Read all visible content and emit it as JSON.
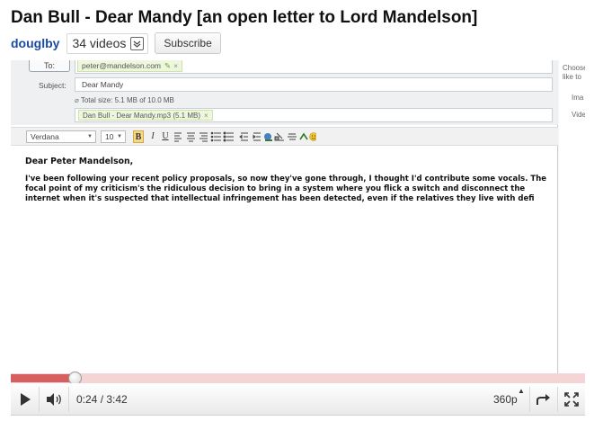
{
  "header": {
    "title": "Dan Bull - Dear Mandy [an open letter to Lord Mandelson]",
    "channel": "douglby",
    "videos_count": "34 videos",
    "subscribe_label": "Subscribe"
  },
  "email": {
    "to_button": "To:",
    "to_value": "peter@mandelson.com",
    "subject_label": "Subject:",
    "subject_value": "Dear Mandy",
    "total_size": "Total size: 5.1 MB of 10.0 MB",
    "attachment": "Dan Bull - Dear Mandy.mp3 (5.1 MB)",
    "toolbar": {
      "font": "Verdana",
      "font_size": "10",
      "bold": "B",
      "italic": "I",
      "underline": "U"
    },
    "body": {
      "greeting": "Dear Peter Mandelson,",
      "lines": [
        "I've been following your recent policy proposals, so now they've gone through, I thought I'd contribute some vocals. The",
        "focal point of my criticism's the ridiculous decision to bring in a system where you flick a switch and disconnect the",
        "internet when it's suspected that intellectual infringement has been detected, even if the relatives they live with defi"
      ]
    },
    "side_panel": {
      "line1": "Choose",
      "line2": "like to",
      "line3": "Ima",
      "line4": "Vide"
    }
  },
  "player": {
    "progress_fraction": 0.113,
    "time": "0:24 / 3:42",
    "quality": "360p",
    "colors": {
      "progress_played": "#d75f5f",
      "progress_track": "#f4d4d4"
    },
    "icons": [
      "play-icon",
      "volume-icon",
      "popout-icon",
      "fullscreen-icon"
    ]
  }
}
